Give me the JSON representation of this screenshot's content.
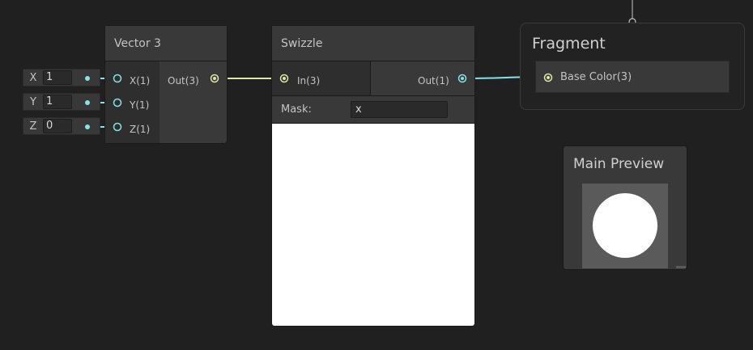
{
  "vector3": {
    "title": "Vector 3",
    "inputs": [
      {
        "port_label": "X(1)",
        "field_label": "X",
        "field_value": "1"
      },
      {
        "port_label": "Y(1)",
        "field_label": "Y",
        "field_value": "1"
      },
      {
        "port_label": "Z(1)",
        "field_label": "Z",
        "field_value": "0"
      }
    ],
    "output_label": "Out(3)"
  },
  "swizzle": {
    "title": "Swizzle",
    "input_label": "In(3)",
    "output_label": "Out(1)",
    "mask_label": "Mask:",
    "mask_value": "x"
  },
  "fragment": {
    "title": "Fragment",
    "port_label": "Base Color(3)"
  },
  "main_preview": {
    "title": "Main Preview"
  },
  "colors": {
    "background": "#202020",
    "node": "#393939",
    "vector3_wire": "#e0e6a8",
    "vector1_wire": "#84e4e7"
  }
}
